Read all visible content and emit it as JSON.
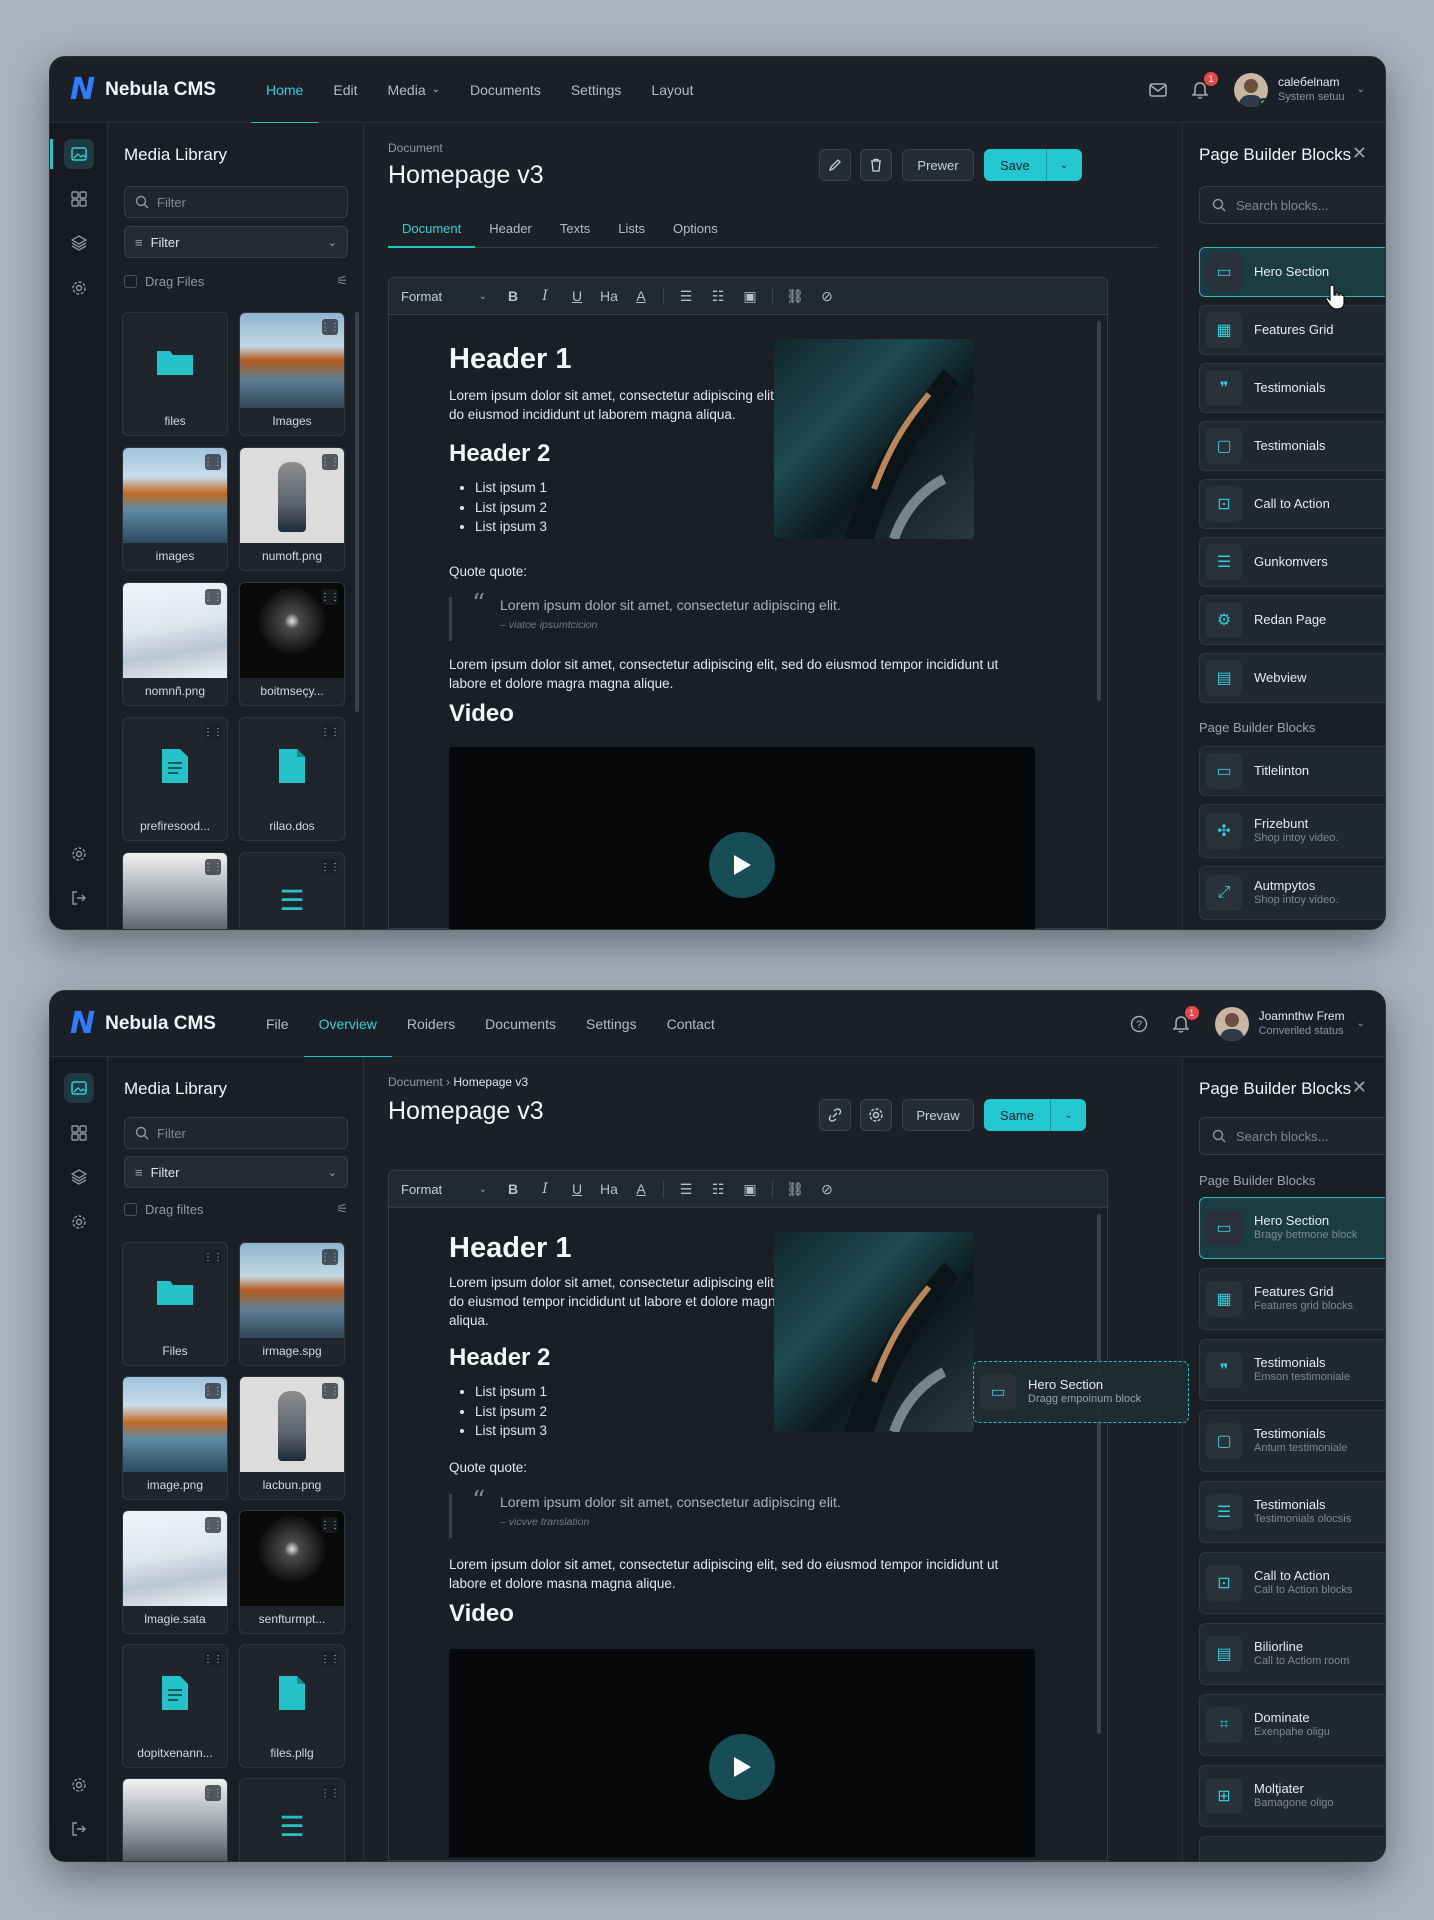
{
  "app": {
    "name": "Nebula CMS",
    "logo_glyph": "N"
  },
  "colors": {
    "accent": "#22c7cf",
    "background": "#181d24",
    "notification": "#e5484d",
    "online": "#2ecc71"
  },
  "screen1": {
    "nav": [
      "Home",
      "Edit",
      "Media",
      "Documents",
      "Settings",
      "Layout"
    ],
    "active_nav": "Home",
    "notif_count": "1",
    "user": {
      "name": "caleбelnam",
      "status": "System setuu"
    },
    "media": {
      "title": "Media Library",
      "filter_placeholder": "Filter",
      "filter_select": "Filter",
      "drag_label": "Drag Files",
      "tiles": [
        "files",
        "Images",
        "images",
        "numoft.png",
        "nomnñ.png",
        "boitmseçy...",
        "prefiresood...",
        "rilao.dos"
      ]
    },
    "doc": {
      "breadcrumb": "Document",
      "title": "Homepage v3",
      "preview_label": "Prewer",
      "save_label": "Save",
      "tabs": [
        "Document",
        "Header",
        "Texts",
        "Lists",
        "Options"
      ],
      "format_label": "Format",
      "h1": "Header 1",
      "p1": "Lorem ipsum dolor sit amet, consectetur adipiscing elit, sed do eiusmod incididunt ut laborem magna aliqua.",
      "h2": "Header 2",
      "list": [
        "List ipsum 1",
        "List ipsum 2",
        "List ipsum 3"
      ],
      "quote_label": "Quote quote:",
      "quote": "Lorem ipsum dolor sit amet, consectetur adipiscing elit.",
      "quote_src": "– viatoe ipsumtcicion",
      "p2": "Lorem ipsum dolor sit amet, consectetur adipiscing elit, sed do eiusmod tempor incididunt ut labore et dolore magra magna alique.",
      "video_heading": "Video"
    },
    "blocks": {
      "title": "Page Builder Blocks",
      "search_placeholder": "Search blocks...",
      "items": [
        {
          "name": "Hero Section",
          "icon": "image-icon"
        },
        {
          "name": "Features Grid",
          "icon": "grid-icon"
        },
        {
          "name": "Testimonials",
          "icon": "quote-icon"
        },
        {
          "name": "Testimonials",
          "icon": "chat-icon"
        },
        {
          "name": "Call to Action",
          "icon": "cta-icon"
        },
        {
          "name": "Gunkomvers",
          "icon": "list-icon"
        },
        {
          "name": "Redan Page",
          "icon": "gear-icon"
        },
        {
          "name": "Webview",
          "icon": "web-icon"
        }
      ],
      "section2": "Page Builder Blocks",
      "items2": [
        {
          "name": "Titlelinton",
          "sub": ""
        },
        {
          "name": "Frizebunt",
          "sub": "Shop intoy video."
        },
        {
          "name": "Autmpytos",
          "sub": "Shop intoy video."
        }
      ]
    }
  },
  "screen2": {
    "nav": [
      "File",
      "Overview",
      "Roiders",
      "Documents",
      "Settings",
      "Contact"
    ],
    "active_nav": "Overview",
    "notif_count": "1",
    "user": {
      "name": "Joamnthw Frem",
      "status": "Converiled status"
    },
    "media": {
      "title": "Media Library",
      "filter_placeholder": "Filter",
      "filter_select": "Filter",
      "drag_label": "Drag filtes",
      "tiles": [
        "Files",
        "irmage.spg",
        "image.png",
        "lacbun.png",
        "lmagie.sata",
        "senfturmpt...",
        "dopitxenann...",
        "files.pllg"
      ]
    },
    "doc": {
      "breadcrumb": "Document",
      "breadcrumb_current": "Homepage v3",
      "title": "Homepage v3",
      "preview_label": "Prevaw",
      "save_label": "Same",
      "format_label": "Format",
      "h1": "Header 1",
      "p1": "Lorem ipsum dolor sit amet, consectetur adipiscing elit, sed do eiusmod tempor incididunt ut labore et dolore magna aliqua.",
      "h2": "Header 2",
      "list": [
        "List ipsum 1",
        "List ipsum 2",
        "List ipsum 3"
      ],
      "quote_label": "Quote quote:",
      "quote": "Lorem ipsum dolor sit amet, consectetur adipiscing elit.",
      "quote_src": "– vicvve translation",
      "p2": "Lorem ipsum dolor sit amet, consectetur adipiscing elit, sed do eiusmod tempor incididunt ut labore et dolore masna magna alique.",
      "video_heading": "Video",
      "ghost": {
        "name": "Hero Section",
        "sub": "Dragg empoinum block"
      }
    },
    "blocks": {
      "title": "Page Builder Blocks",
      "search_placeholder": "Search blocks...",
      "section": "Page Builder Blocks",
      "items": [
        {
          "name": "Hero Section",
          "sub": "Bragy betmone block"
        },
        {
          "name": "Features Grid",
          "sub": "Features grid blocks"
        },
        {
          "name": "Testimonials",
          "sub": "Emson testimoniale"
        },
        {
          "name": "Testimonials",
          "sub": "Antum testimoniale"
        },
        {
          "name": "Testimonials",
          "sub": "Testimonials olocsis"
        },
        {
          "name": "Call to Action",
          "sub": "Call to Action blocks"
        },
        {
          "name": "Biliorline",
          "sub": "Call to Actiom room"
        },
        {
          "name": "Dominate",
          "sub": "Exenpahe oligu"
        },
        {
          "name": "Molţiater",
          "sub": "Bamagone oligo"
        }
      ]
    }
  }
}
